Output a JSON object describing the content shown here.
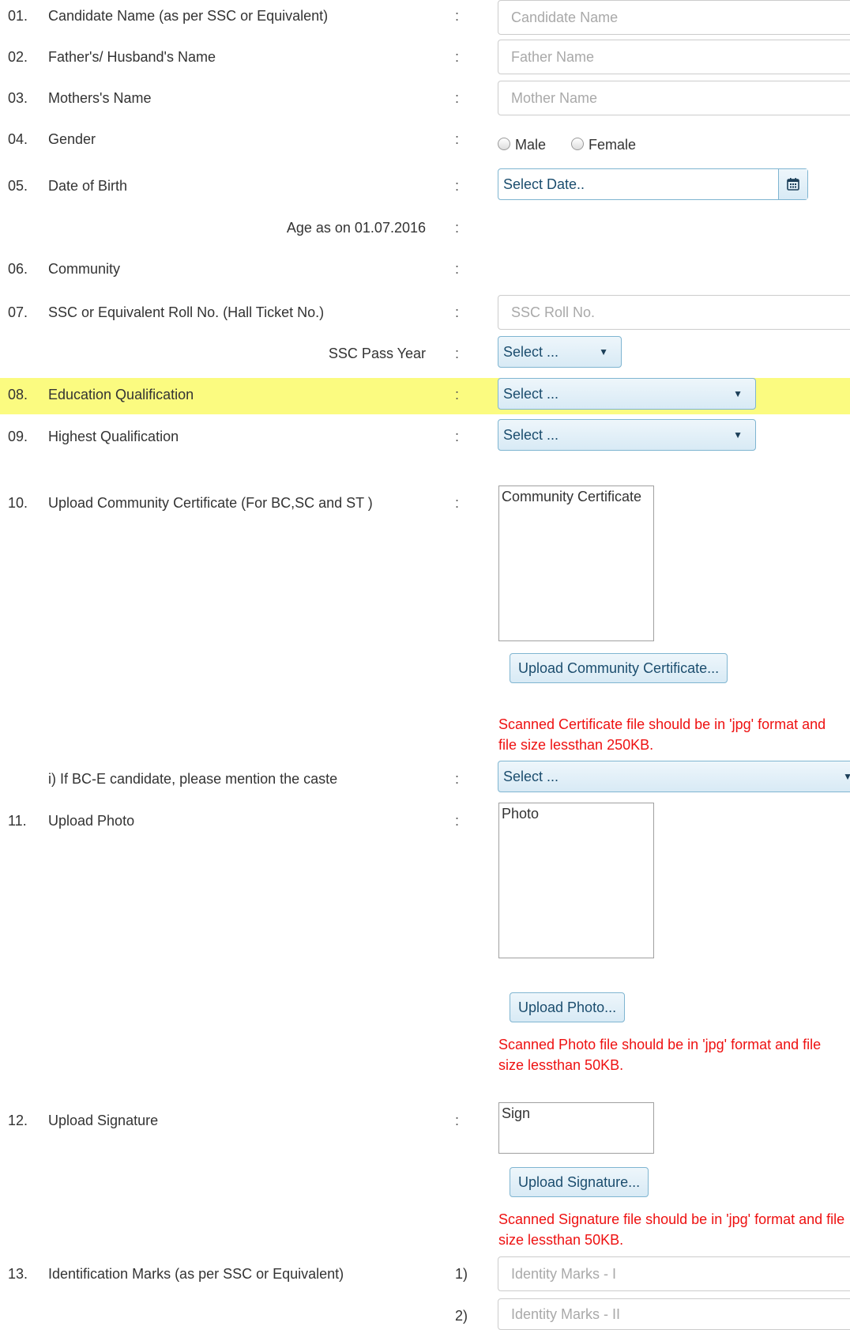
{
  "rows": [
    {
      "num": "01.",
      "label": "Candidate Name (as per SSC or Equivalent)",
      "colon": ":",
      "placeholder": "Candidate Name"
    },
    {
      "num": "02.",
      "label": "Father's/ Husband's Name",
      "colon": ":",
      "placeholder": "Father Name"
    },
    {
      "num": "03.",
      "label": "Mothers's Name",
      "colon": ":",
      "placeholder": "Mother Name"
    },
    {
      "num": "04.",
      "label": "Gender",
      "colon": ":",
      "options": [
        "Male",
        "Female"
      ]
    },
    {
      "num": "05.",
      "label": "Date of Birth",
      "colon": ":",
      "placeholder": "Select Date.."
    },
    {
      "label": "Age as on 01.07.2016",
      "colon": ":"
    },
    {
      "num": "06.",
      "label": "Community",
      "colon": ":"
    },
    {
      "num": "07.",
      "label": "SSC or Equivalent Roll No. (Hall Ticket No.)",
      "colon": ":",
      "placeholder": "SSC Roll No."
    },
    {
      "label": "SSC Pass Year",
      "colon": ":",
      "select": "Select ..."
    },
    {
      "num": "08.",
      "label": "Education Qualification",
      "colon": ":",
      "select": "Select ..."
    },
    {
      "num": "09.",
      "label": "Highest Qualification",
      "colon": ":",
      "select": "Select ..."
    },
    {
      "num": "10.",
      "label": "Upload Community Certificate (For BC,SC and ST )",
      "colon": ":",
      "preview": "Community Certificate",
      "button": "Upload Community Certificate...",
      "hint": [
        "Scanned Certificate file should be in 'jpg' format and",
        "file size lessthan 250KB."
      ]
    },
    {
      "label": "i) If BC-E candidate, please mention the caste",
      "colon": ":",
      "select": "Select ..."
    },
    {
      "num": "11.",
      "label": "Upload Photo",
      "colon": ":",
      "preview": "Photo",
      "button": "Upload Photo...",
      "hint": [
        "Scanned Photo file should be in 'jpg' format and file",
        "size lessthan 50KB."
      ]
    },
    {
      "num": "12.",
      "label": "Upload Signature",
      "colon": ":",
      "preview": "Sign",
      "button": "Upload Signature...",
      "hint": [
        "Scanned Signature file should be in 'jpg' format and file",
        "size lessthan 50KB."
      ]
    },
    {
      "num": "13.",
      "label": "Identification Marks (as per SSC or Equivalent)",
      "marks": [
        {
          "idx": "1)",
          "placeholder": "Identity Marks - I"
        },
        {
          "idx": "2)",
          "placeholder": "Identity Marks - II"
        }
      ]
    }
  ],
  "icons": {
    "calendar": "calendar-icon",
    "caret": "caret-down-icon"
  },
  "colors": {
    "highlight": "#fbfb80",
    "hint": "#ee1111",
    "button_text": "#1b4d6e",
    "button_border": "#7fb5d1"
  }
}
